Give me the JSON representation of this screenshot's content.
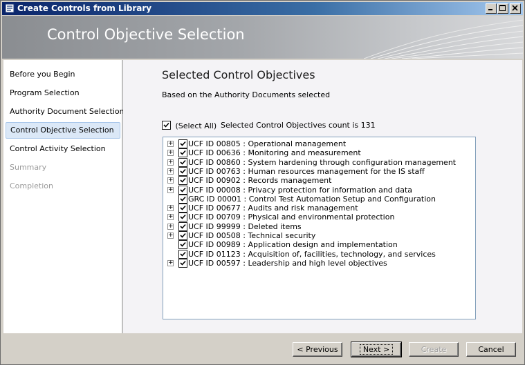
{
  "window": {
    "title": "Create Controls from Library"
  },
  "banner": {
    "title": "Control Objective Selection"
  },
  "nav": {
    "items": [
      {
        "label": "Before you Begin",
        "state": "normal"
      },
      {
        "label": "Program Selection",
        "state": "normal"
      },
      {
        "label": "Authority Document Selection",
        "state": "normal"
      },
      {
        "label": "Control Objective Selection",
        "state": "active"
      },
      {
        "label": "Control Activity Selection",
        "state": "normal"
      },
      {
        "label": "Summary",
        "state": "disabled"
      },
      {
        "label": "Completion",
        "state": "disabled"
      }
    ]
  },
  "main": {
    "title": "Selected Control Objectives",
    "subtitle": "Based on the Authority Documents selected",
    "select_all_label": "(Select All)",
    "select_all_checked": true,
    "count_label": "Selected Control Objectives count is 131"
  },
  "tree": {
    "items": [
      {
        "label": "UCF ID 00805 : Operational management",
        "expandable": true,
        "checked": true
      },
      {
        "label": "UCF ID 00636 : Monitoring and measurement",
        "expandable": true,
        "checked": true
      },
      {
        "label": "UCF ID 00860 : System hardening through configuration management",
        "expandable": true,
        "checked": true
      },
      {
        "label": "UCF ID 00763 : Human resources management for the IS staff",
        "expandable": true,
        "checked": true
      },
      {
        "label": "UCF ID 00902 : Records management",
        "expandable": true,
        "checked": true
      },
      {
        "label": "UCF ID 00008 : Privacy protection for information and data",
        "expandable": true,
        "checked": true
      },
      {
        "label": "GRC ID 00001 : Control Test Automation Setup and Configuration",
        "expandable": false,
        "checked": true
      },
      {
        "label": "UCF ID 00677 : Audits and risk management",
        "expandable": true,
        "checked": true
      },
      {
        "label": "UCF ID 00709 : Physical and environmental protection",
        "expandable": true,
        "checked": true
      },
      {
        "label": "UCF ID 99999 : Deleted items",
        "expandable": true,
        "checked": true
      },
      {
        "label": "UCF ID 00508 : Technical security",
        "expandable": true,
        "checked": true
      },
      {
        "label": "UCF ID 00989 : Application design and implementation",
        "expandable": false,
        "checked": true
      },
      {
        "label": "UCF ID 01123 : Acquisition of, facilities, technology, and services",
        "expandable": false,
        "checked": true
      },
      {
        "label": "UCF ID 00597 : Leadership and high level objectives",
        "expandable": true,
        "checked": true
      }
    ]
  },
  "buttons": {
    "previous": "< Previous",
    "next": "Next >",
    "create": "Create",
    "cancel": "Cancel"
  },
  "colors": {
    "title_bar": "#0a246a",
    "active_nav": "#dbe8f7",
    "tree_border": "#7f9db9"
  },
  "icons": {
    "window": "app-icon",
    "minimize": "minimize-icon",
    "maximize": "maximize-icon",
    "close": "close-icon"
  }
}
